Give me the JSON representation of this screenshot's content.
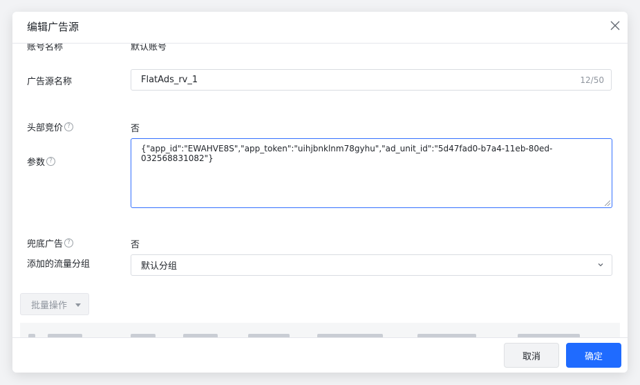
{
  "dialog": {
    "title": "编辑广告源",
    "close_icon": "close-icon"
  },
  "form": {
    "account_name": {
      "label": "账号名称",
      "value": "默认账号"
    },
    "source_name": {
      "label": "广告源名称",
      "value": "FlatAds_rv_1",
      "counter": "12/50"
    },
    "header_bidding": {
      "label": "头部竞价",
      "value": "否"
    },
    "params": {
      "label": "参数",
      "value": "{\"app_id\":\"EWAHVE8S\",\"app_token\":\"uihjbnklnm78gyhu\",\"ad_unit_id\":\"5d47fad0-b7a4-11eb-80ed-032568831082\"}"
    },
    "fallback_ad": {
      "label": "兜底广告",
      "value": "否"
    },
    "traffic_group": {
      "label": "添加的流量分组",
      "selected": "默认分组"
    }
  },
  "batch": {
    "label": "批量操作"
  },
  "footer": {
    "cancel_label": "取消",
    "ok_label": "确定"
  },
  "colors": {
    "primary": "#1f6bff",
    "focus_border": "#3370ff"
  }
}
